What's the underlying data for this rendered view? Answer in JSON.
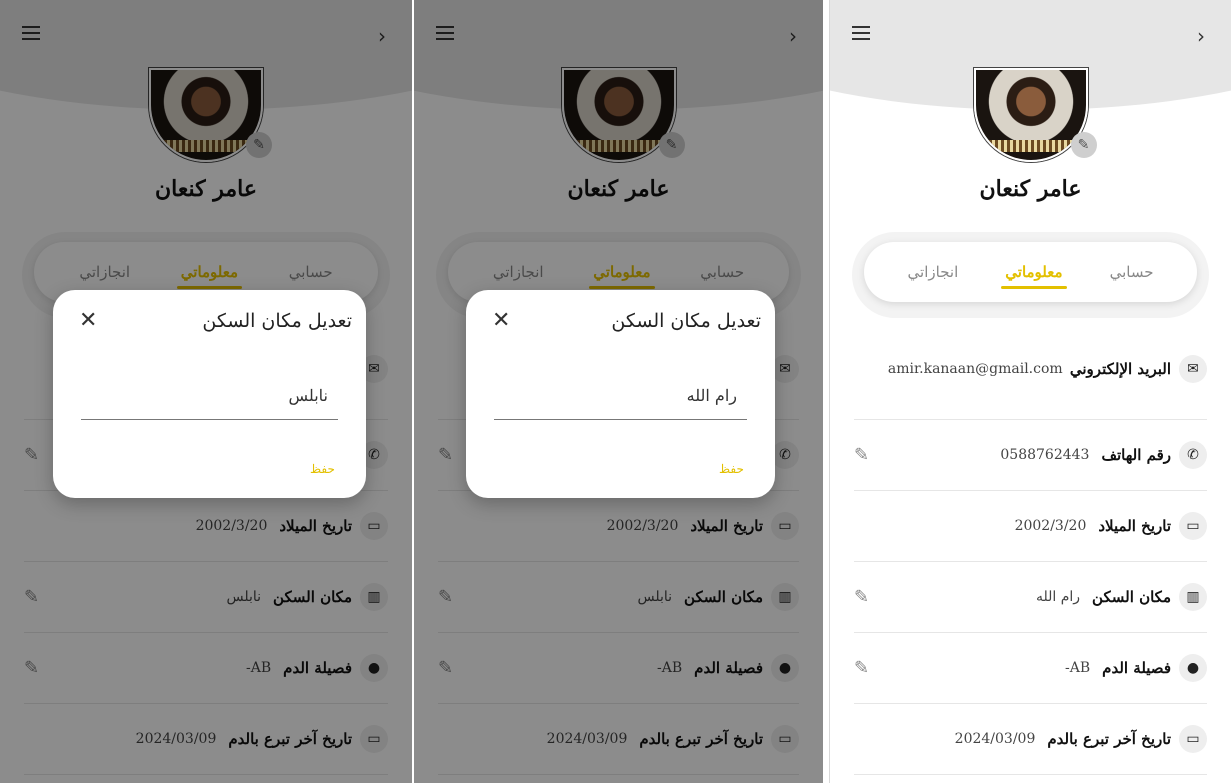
{
  "profile": {
    "name": "عامر كنعان",
    "tabs": {
      "account": "حسابي",
      "info": "معلوماتي",
      "achievements": "انجازاتي"
    }
  },
  "fields": {
    "email_label": "البريد الإلكتروني",
    "email_value": "amir.kanaan@gmail.com",
    "phone_label": "رقم الهاتف",
    "phone_value": "0588762443",
    "birth_label": "تاريخ الميلاد",
    "birth_value": "2002/3/20",
    "residence_label": "مكان السكن",
    "blood_label": "فصيلة الدم",
    "blood_value": "AB-",
    "last_donation_label": "تاريخ آخر تبرع بالدم",
    "last_donation_value": "2024/03/09"
  },
  "screens": {
    "s1": {
      "residence_value": "نابلس",
      "dialog_input": "نابلس"
    },
    "s2": {
      "residence_value": "نابلس",
      "dialog_input": "رام الله"
    },
    "s3": {
      "residence_value": "رام الله"
    }
  },
  "dialog": {
    "title": "تعديل مكان السكن",
    "save_label": "حفظ"
  },
  "icons": {
    "menu": "menu-icon",
    "back": "chevron-right-icon",
    "email": "email-icon",
    "phone": "phone-icon",
    "calendar": "calendar-icon",
    "city": "city-icon",
    "blood": "blood-drop-icon",
    "edit": "pencil-icon",
    "close": "close-icon"
  },
  "colors": {
    "accent": "#e3c000",
    "overlay": "rgba(0,0,0,0.45)"
  }
}
